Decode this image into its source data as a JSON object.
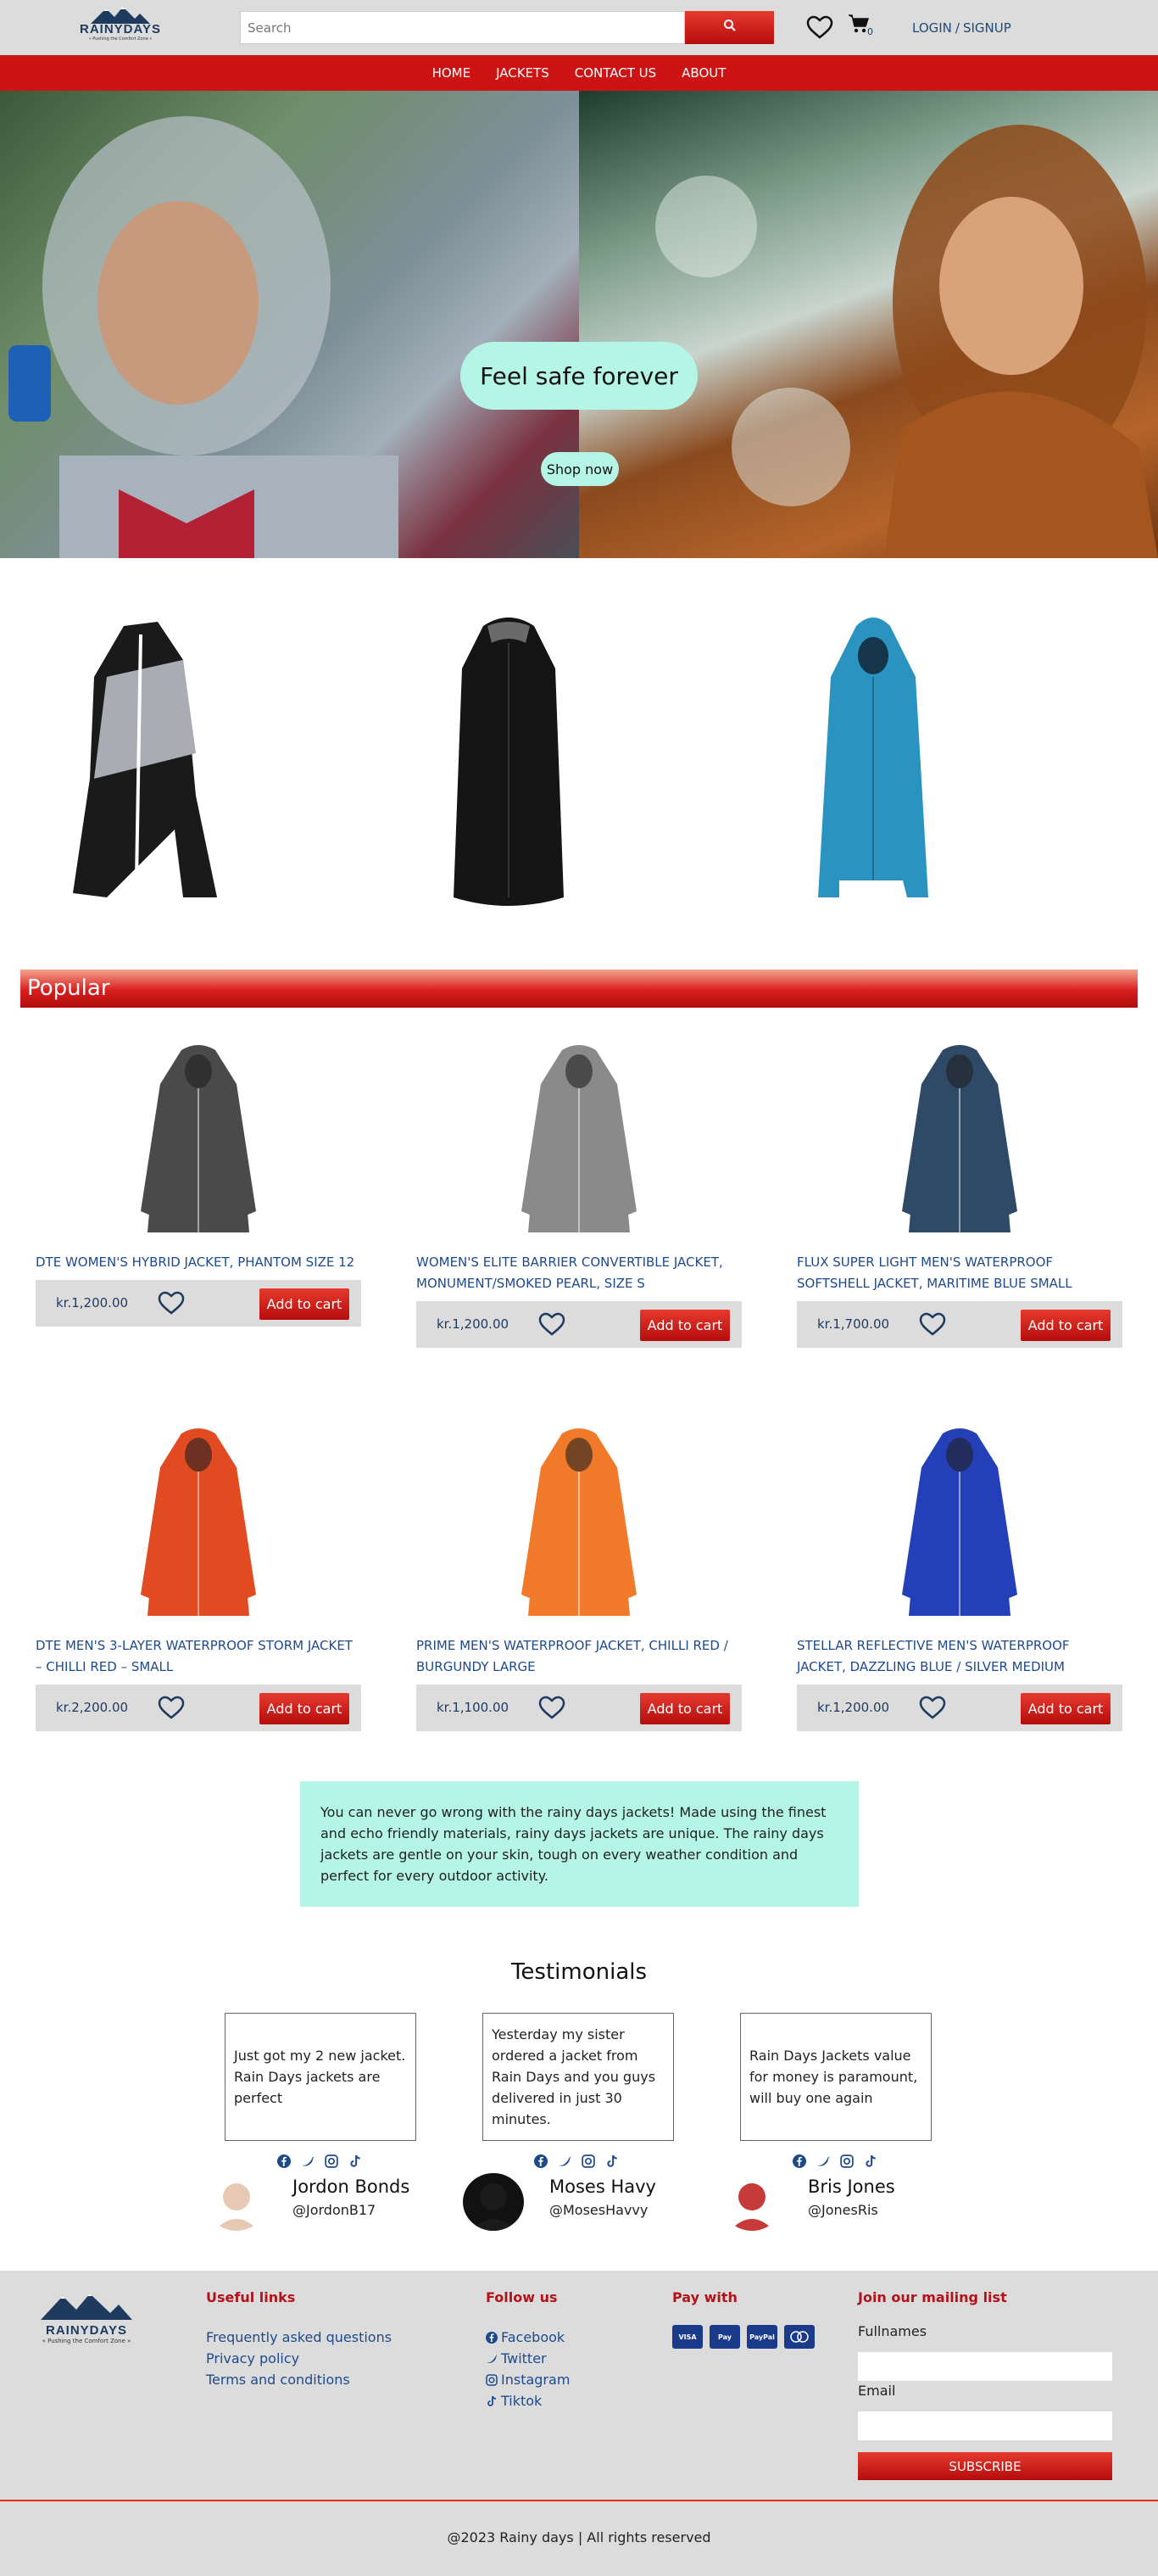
{
  "brand": {
    "name": "RAINYDAYS",
    "tagline": "« Pushing the Comfort Zone »"
  },
  "search": {
    "placeholder": "Search"
  },
  "cart": {
    "count": "0"
  },
  "auth": {
    "login": "LOGIN",
    "separator": "/",
    "signup": "SIGNUP"
  },
  "nav": [
    "HOME",
    "JACKETS",
    "CONTACT US",
    "ABOUT"
  ],
  "hero": {
    "title": "Feel safe forever",
    "button": "Shop now"
  },
  "popular": {
    "heading": "Popular"
  },
  "products": [
    {
      "title": "DTE WOMEN'S HYBRID JACKET, PHANTOM SIZE 12",
      "price": "kr.1,200.00",
      "add": "Add to cart",
      "color": "#4a4a4a"
    },
    {
      "title": "WOMEN'S ELITE BARRIER CONVERTIBLE JACKET, MONUMENT/SMOKED PEARL, SIZE S",
      "price": "kr.1,200.00",
      "add": "Add to cart",
      "color": "#8a8a8a"
    },
    {
      "title": "FLUX SUPER LIGHT MEN'S WATERPROOF SOFTSHELL JACKET, MARITIME BLUE SMALL",
      "price": "kr.1,700.00",
      "add": "Add to cart",
      "color": "#2e4a66"
    },
    {
      "title": "DTE MEN'S 3-LAYER WATERPROOF STORM JACKET – CHILLI RED – SMALL",
      "price": "kr.2,200.00",
      "add": "Add to cart",
      "color": "#e24a22"
    },
    {
      "title": "PRIME MEN'S WATERPROOF JACKET, CHILLI RED / BURGUNDY LARGE",
      "price": "kr.1,100.00",
      "add": "Add to cart",
      "color": "#f07a2a"
    },
    {
      "title": "STELLAR REFLECTIVE MEN'S WATERPROOF JACKET, DAZZLING BLUE / SILVER MEDIUM",
      "price": "kr.1,200.00",
      "add": "Add to cart",
      "color": "#2440b8"
    }
  ],
  "info": {
    "text": "You can never go wrong with the rainy days jackets! Made using the finest and echo friendly materials, rainy days jackets are unique. The rainy days jackets are gentle on your skin, tough on every weather condition and perfect for every outdoor activity."
  },
  "testimonials": {
    "heading": "Testimonials",
    "items": [
      {
        "quote": "Just got my 2 new jacket. Rain Days jackets are perfect",
        "name": "Jordon Bonds",
        "handle": "@JordonB17"
      },
      {
        "quote": "Yesterday my sister ordered a jacket from Rain Days and you guys delivered in just 30 minutes.",
        "name": "Moses Havy",
        "handle": "@MosesHavvy"
      },
      {
        "quote": "Rain Days Jackets value for money is paramount, will buy one again",
        "name": "Bris Jones",
        "handle": "@JonesRis"
      }
    ]
  },
  "footer": {
    "useful": {
      "heading": "Useful links",
      "links": [
        "Frequently asked questions",
        "Privacy policy",
        "Terms and conditions"
      ]
    },
    "follow": {
      "heading": "Follow us",
      "links": [
        "Facebook",
        "Twitter",
        "Instagram",
        "Tiktok"
      ]
    },
    "pay": {
      "heading": "Pay with",
      "cards": [
        "VISA",
        "Pay",
        "PayPal",
        "MC"
      ]
    },
    "mailing": {
      "heading": "Join our mailing list",
      "fullnames": "Fullnames",
      "email": "Email",
      "subscribe": "SUBSCRIBE"
    },
    "copyright": "@2023 Rainy days | All rights reserved"
  },
  "colors": {
    "accent": "#cc1414",
    "mint": "#b4f5e6",
    "link": "#1e4a8c",
    "gray": "#dcdcdc"
  }
}
